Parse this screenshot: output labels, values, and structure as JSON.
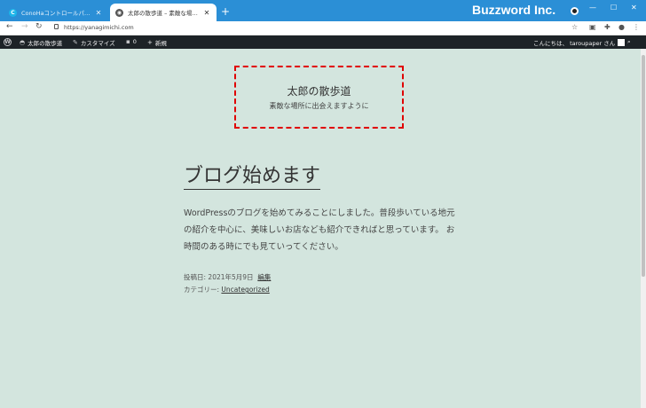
{
  "browser": {
    "tabs": [
      {
        "title": "ConoHaコントロールパネル",
        "favicon": "C",
        "active": false
      },
      {
        "title": "太郎の散歩道 – 素敵な場所に出会えますように",
        "favicon": "globe",
        "active": true
      }
    ],
    "new_tab": "+",
    "brand": "Buzzword Inc.",
    "url": "https://yanagimichi.com",
    "window_controls": {
      "minimize": "—",
      "maximize": "☐",
      "close": "✕"
    }
  },
  "adminbar": {
    "site_name": "太郎の散歩道",
    "customize": "カスタマイズ",
    "comments_count": "0",
    "new_label": "新規",
    "greeting": "こんにちは、 taroupaper さん"
  },
  "site": {
    "title": "太郎の散歩道",
    "description": "素敵な場所に出会えますように"
  },
  "post": {
    "title": "ブログ始めます",
    "body": "WordPressのブログを始めてみることにしました。普段歩いている地元の紹介を中心に、美味しいお店なども紹介できればと思っています。 お時間のある時にでも見ていってください。",
    "date_label": "投稿日:",
    "date": "2021年5月9日",
    "edit": "編集",
    "category_label": "カテゴリー:",
    "category": "Uncategorized"
  },
  "colors": {
    "titlebar": "#2b8fd6",
    "page_bg": "#d3e5de",
    "adminbar": "#1d2327",
    "highlight": "#e00000"
  }
}
